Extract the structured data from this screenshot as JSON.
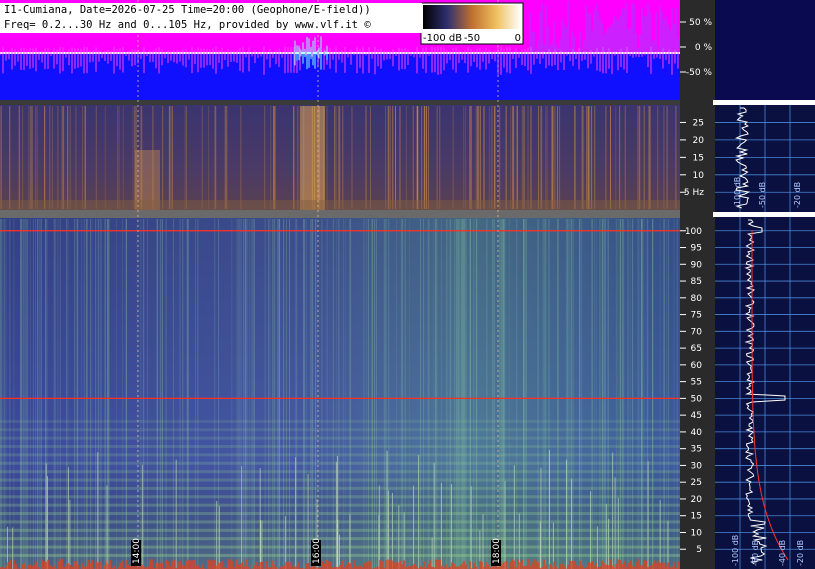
{
  "header": {
    "line1": "I1-Cumiana, Date=2026-07-25 Time=20:00 (Geophone/E-field))",
    "line2": "Freq= 0.2...30 Hz and 0...105 Hz, provided by www.vlf.it ©"
  },
  "colorbar": {
    "labels": [
      "-100 dB",
      "-50",
      "0"
    ],
    "ticks": [
      -100,
      -50,
      0
    ]
  },
  "colors": {
    "amplitude_bg": "#ff00ff",
    "amplitude_trace_bg": "#1010ff",
    "spectrum_bg": "#0a1040",
    "grid": "#4a88d8",
    "marker_line": "#ff3020",
    "time_line": "#e0c8a0"
  },
  "chart_data": [
    {
      "type": "line",
      "name": "amplitude",
      "ylabel_ticks": [
        "50 %",
        "0 %",
        "-50 %"
      ],
      "y_values": [
        50,
        0,
        -50
      ],
      "ylim": [
        -100,
        100
      ]
    },
    {
      "type": "heatmap",
      "name": "spectrogram-low",
      "y_ticks": [
        "25",
        "20",
        "15",
        "10",
        "5 Hz"
      ],
      "y_values": [
        25,
        20,
        15,
        10,
        5
      ],
      "ylim": [
        0.2,
        30
      ],
      "profile_x_labels": [
        "-100 dB",
        "-50 dB",
        "-20 dB"
      ]
    },
    {
      "type": "heatmap",
      "name": "spectrogram-high",
      "y_ticks": [
        "100",
        "95",
        "90",
        "85",
        "80",
        "75",
        "70",
        "65",
        "60",
        "55",
        "50",
        "45",
        "40",
        "35",
        "30",
        "25",
        "20",
        "15",
        "10",
        "5"
      ],
      "y_values": [
        100,
        95,
        90,
        85,
        80,
        75,
        70,
        65,
        60,
        55,
        50,
        45,
        40,
        35,
        30,
        25,
        20,
        15,
        10,
        5
      ],
      "ylim": [
        0,
        105
      ],
      "x_ticks": [
        "14:00",
        "16:00",
        "18:00"
      ],
      "markers_hz": [
        50,
        100
      ],
      "profile_x_labels": [
        "-100 dB",
        "-60 dB",
        "-40 dB",
        "-20 dB"
      ]
    }
  ]
}
